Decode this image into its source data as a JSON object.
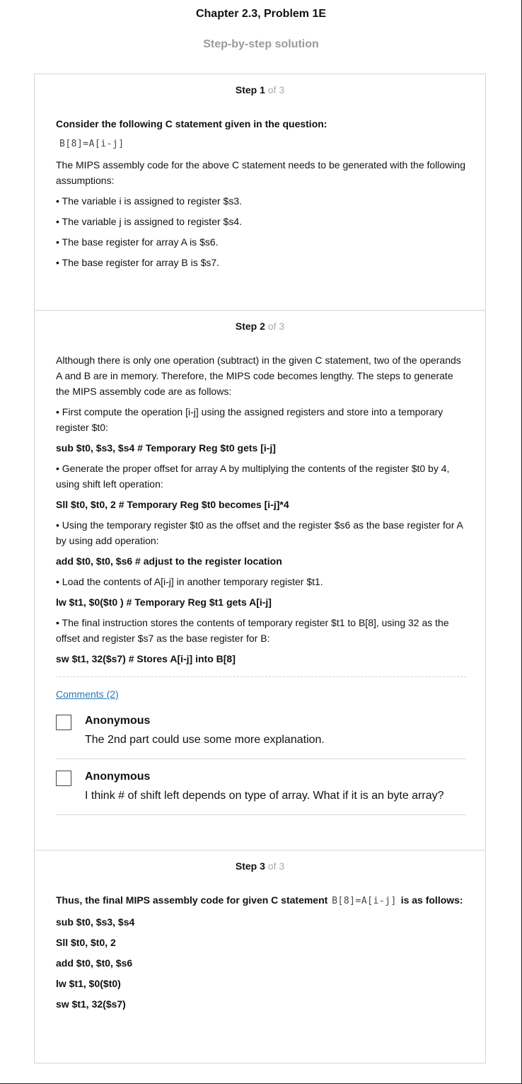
{
  "header": {
    "title": "Chapter 2.3, Problem 1E",
    "subtitle": "Step-by-step solution"
  },
  "steps": [
    {
      "step_word": "Step ",
      "number": "1",
      "of": " of 3",
      "intro": "Consider the following C statement given in the question:",
      "code": "B[8]=A[i-j]",
      "text": "The MIPS assembly code for the above C statement needs to be generated with the following assumptions:",
      "bullets": [
        "• The variable i is assigned to register $s3.",
        "• The variable j is assigned to register $s4.",
        "• The base register for array A is $s6.",
        "• The base register for array B is $s7."
      ]
    },
    {
      "step_word": "Step ",
      "number": "2",
      "of": " of 3",
      "intro": "Although there is only one operation (subtract) in the given C statement, two of the operands A and B are in memory. Therefore, the MIPS code becomes lengthy. The steps to generate the MIPS assembly code are as follows:",
      "b1": "• First compute the operation [i-j] using the assigned registers and store into a temporary register $t0:",
      "c1": "sub $t0, $s3, $s4 # Temporary Reg $t0 gets [i-j]",
      "b2": "• Generate the proper offset for array A by multiplying the contents of the register $t0 by 4, using shift left operation:",
      "c2": "Sll $t0, $t0, 2 # Temporary Reg $t0 becomes [i-j]*4",
      "b3": "• Using the temporary register $t0 as the offset and the register $s6 as the base register for A by using add operation:",
      "c3": "add $t0, $t0, $s6 # adjust to the register location",
      "b4": "• Load the contents of A[i-j] in another temporary register $t1.",
      "c4": "lw $t1, $0($t0 ) # Temporary Reg $t1 gets A[i-j]",
      "b5": "• The final instruction stores the contents of temporary register $t1 to B[8], using 32 as the offset and register $s7 as the base register for B:",
      "c5": "sw $t1, 32($s7) # Stores A[i-j] into B[8]",
      "comments_label": "Comments (2)",
      "comments": [
        {
          "author": "Anonymous",
          "text": "The 2nd part could use some more explanation."
        },
        {
          "author": "Anonymous",
          "text": "I think # of shift left depends on type of array. What if it is an byte array?"
        }
      ]
    },
    {
      "step_word": "Step ",
      "number": "3",
      "of": " of 3",
      "intro_a": "Thus, the final MIPS assembly code for given C statement",
      "code": "B[8]=A[i-j]",
      "intro_b": "is as follows:",
      "lines": [
        "sub $t0, $s3, $s4",
        "Sll $t0, $t0, 2",
        "add $t0, $t0, $s6",
        "lw $t1, $0($t0)",
        "sw $t1, 32($s7)"
      ]
    }
  ]
}
